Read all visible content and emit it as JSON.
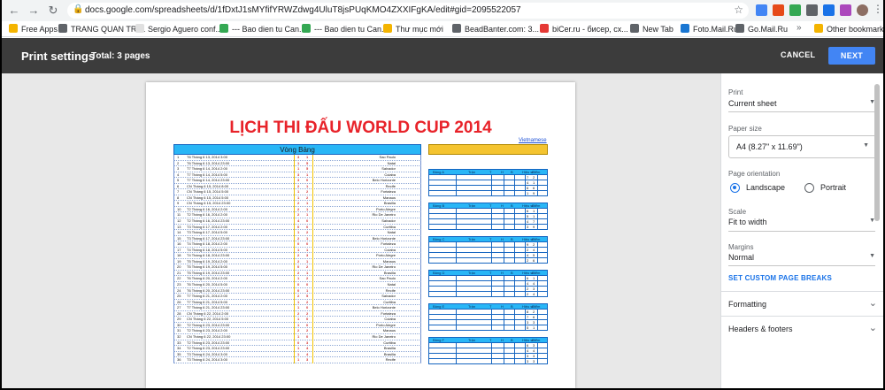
{
  "browser": {
    "url": "docs.google.com/spreadsheets/d/1fDxtJ1sMYfifYRWZdwg4UluT8jsPUqKMO4ZXXIFgKA/edit#gid=2095522057",
    "bookmarks": [
      {
        "label": "Free Apps",
        "color": "#f4b400"
      },
      {
        "label": "TRANG QUAN TRI...",
        "color": "#5f6368"
      },
      {
        "label": "Sergio Aguero conf...",
        "color": "#e0e0e0"
      },
      {
        "label": "--- Bao dien tu Can...",
        "color": "#34a853"
      },
      {
        "label": "--- Bao dien tu Can...",
        "color": "#34a853"
      },
      {
        "label": "Thư mục mới",
        "color": "#f4b400"
      },
      {
        "label": "BeadBanter.com: 3...",
        "color": "#5f6368"
      },
      {
        "label": "biCer.ru - бисер, сх...",
        "color": "#e53935"
      },
      {
        "label": "New Tab",
        "color": "#5f6368"
      },
      {
        "label": "Foto.Mail.Ru",
        "color": "#1976d2"
      },
      {
        "label": "Go.Mail.Ru",
        "color": "#5f6368"
      }
    ],
    "more_label": "»",
    "other_bookmarks": "Other bookmarks"
  },
  "header": {
    "title": "Print settings",
    "total": "Total: 3 pages",
    "cancel": "CANCEL",
    "next": "NEXT",
    "accent": "#4285f4"
  },
  "sheet": {
    "title": "LỊCH THI ĐẤU WORLD CUP 2014",
    "link": "Vietnamese",
    "group_stage_label": "Vòng Bảng",
    "matches": [
      {
        "n": "1",
        "d": "T6  Tháng 6 13, 2014   3:00",
        "s1": "3",
        "s2": "1",
        "v": "Sao Paulo"
      },
      {
        "n": "2",
        "d": "T6  Tháng 6 13, 2014   23:00",
        "s1": "1",
        "s2": "5",
        "v": "Natal"
      },
      {
        "n": "3",
        "d": "T7  Tháng 6 14, 2014   2:00",
        "s1": "1",
        "s2": "5",
        "v": "Salvador"
      },
      {
        "n": "4",
        "d": "T7  Tháng 6 14, 2014   5:00",
        "s1": "3",
        "s2": "1",
        "v": "Cuiaba"
      },
      {
        "n": "5",
        "d": "T7  Tháng 6 14, 2014   23:00",
        "s1": "3",
        "s2": "0",
        "v": "Belo Horizonte"
      },
      {
        "n": "6",
        "d": "CN  Tháng 6 15, 2014   8:00",
        "s1": "2",
        "s2": "1",
        "v": "Recife"
      },
      {
        "n": "7",
        "d": "CN  Tháng 6 15, 2014   5:00",
        "s1": "1",
        "s2": "2",
        "v": "Fortaleza"
      },
      {
        "n": "8",
        "d": "CN  Tháng 6 15, 2014   5:00",
        "s1": "1",
        "s2": "2",
        "v": "Manaus"
      },
      {
        "n": "9",
        "d": "CN  Tháng 6 15, 2014   23:00",
        "s1": "2",
        "s2": "1",
        "v": "Brasilia"
      },
      {
        "n": "10",
        "d": "T2  Tháng 6 16, 2014   2:00",
        "s1": "2",
        "s2": "1",
        "v": "Porto Alegre"
      },
      {
        "n": "11",
        "d": "T2  Tháng 6 16, 2014   2:00",
        "s1": "2",
        "s2": "1",
        "v": "Rio De Janeiro"
      },
      {
        "n": "12",
        "d": "T2  Tháng 6 16, 2014   23:00",
        "s1": "4",
        "s2": "0",
        "v": "Salvador"
      },
      {
        "n": "13",
        "d": "T3  Tháng 6 17, 2014   2:00",
        "s1": "0",
        "s2": "0",
        "v": "Curitiba"
      },
      {
        "n": "14",
        "d": "T3  Tháng 6 17, 2014   5:00",
        "s1": "1",
        "s2": "2",
        "v": "Natal"
      },
      {
        "n": "15",
        "d": "T3  Tháng 6 17, 2014   23:00",
        "s1": "2",
        "s2": "1",
        "v": "Belo Horizonte"
      },
      {
        "n": "16",
        "d": "T4  Tháng 6 18, 2014   2:00",
        "s1": "0",
        "s2": "0",
        "v": "Fortaleza"
      },
      {
        "n": "17",
        "d": "T4  Tháng 6 18, 2014   5:00",
        "s1": "1",
        "s2": "1",
        "v": "Cuiaba"
      },
      {
        "n": "18",
        "d": "T4  Tháng 6 18, 2014   23:00",
        "s1": "2",
        "s2": "3",
        "v": "Porto Alegre"
      },
      {
        "n": "19",
        "d": "T5  Tháng 6 19, 2014   2:00",
        "s1": "2",
        "s2": "1",
        "v": "Manaus"
      },
      {
        "n": "20",
        "d": "T5  Tháng 6 19, 2014   5:00",
        "s1": "0",
        "s2": "2",
        "v": "Rio De Janeiro"
      },
      {
        "n": "21",
        "d": "T5  Tháng 6 19, 2014   23:00",
        "s1": "2",
        "s2": "1",
        "v": "Brasilia"
      },
      {
        "n": "22",
        "d": "T6  Tháng 6 20, 2014   2:00",
        "s1": "1",
        "s2": "2",
        "v": "Sao Paulo"
      },
      {
        "n": "23",
        "d": "T6  Tháng 6 20, 2014   5:00",
        "s1": "0",
        "s2": "0",
        "v": "Natal"
      },
      {
        "n": "24",
        "d": "T6  Tháng 6 20, 2014   23:00",
        "s1": "0",
        "s2": "1",
        "v": "Recife"
      },
      {
        "n": "25",
        "d": "T7  Tháng 6 21, 2014   2:00",
        "s1": "2",
        "s2": "5",
        "v": "Salvador"
      },
      {
        "n": "26",
        "d": "T7  Tháng 6 21, 2014   5:00",
        "s1": "1",
        "s2": "2",
        "v": "Curitiba"
      },
      {
        "n": "27",
        "d": "T7  Tháng 6 21, 2014   23:00",
        "s1": "1",
        "s2": "0",
        "v": "Belo Horizonte"
      },
      {
        "n": "28",
        "d": "CN  Tháng 6 22, 2014   2:00",
        "s1": "2",
        "s2": "2",
        "v": "Fortaleza"
      },
      {
        "n": "29",
        "d": "CN  Tháng 6 22, 2014   5:00",
        "s1": "1",
        "s2": "0",
        "v": "Cuiaba"
      },
      {
        "n": "30",
        "d": "T2  Tháng 6 23, 2014   23:00",
        "s1": "1",
        "s2": "0",
        "v": "Porto Alegre"
      },
      {
        "n": "31",
        "d": "T2  Tháng 6 23, 2014   2:00",
        "s1": "2",
        "s2": "2",
        "v": "Manaus"
      },
      {
        "n": "32",
        "d": "CN  Tháng 6 22, 2014   23:00",
        "s1": "1",
        "s2": "0",
        "v": "Rio De Janeiro"
      },
      {
        "n": "33",
        "d": "T2  Tháng 6 23, 2014   23:00",
        "s1": "0",
        "s2": "3",
        "v": "Curitiba"
      },
      {
        "n": "34",
        "d": "T2  Tháng 6 23, 2014   23:00",
        "s1": "1",
        "s2": "4",
        "v": "Brasilia"
      },
      {
        "n": "35",
        "d": "T3  Tháng 6 24, 2014   3:00",
        "s1": "1",
        "s2": "4",
        "v": "Brasilia"
      },
      {
        "n": "36",
        "d": "T3  Tháng 6 24, 2014   3:00",
        "s1": "1",
        "s2": "3",
        "v": "Recife"
      }
    ],
    "group_headers": [
      "Bảng A",
      "Bảng B",
      "Bảng C",
      "Bảng D",
      "Bảng E",
      "Bảng F"
    ],
    "group_cols": [
      "Trận",
      "T",
      "H",
      "B",
      "Hiệu số",
      "Điểm"
    ],
    "group_points": [
      [
        [
          "7",
          "2"
        ],
        [
          "4",
          "1"
        ],
        [
          "6",
          "6"
        ],
        [
          "1",
          "9"
        ]
      ],
      [
        [
          "6",
          "1"
        ],
        [
          "5",
          "1"
        ],
        [
          "4",
          "7"
        ],
        [
          "3",
          "9"
        ]
      ],
      [
        [
          "9",
          "2"
        ],
        [
          "2",
          "4"
        ],
        [
          "4",
          "5"
        ],
        [
          "2",
          "6"
        ]
      ],
      [
        [
          "6",
          "1"
        ],
        [
          "4",
          "4"
        ],
        [
          "2",
          "3"
        ],
        [
          "2",
          "4"
        ]
      ],
      [
        [
          "8",
          "2"
        ],
        [
          "7",
          "6"
        ],
        [
          "3",
          "3"
        ],
        [
          "5",
          "1"
        ]
      ],
      [
        [
          "6",
          "3"
        ],
        [
          "4",
          "4"
        ],
        [
          "3",
          "3"
        ],
        [
          "3",
          "3"
        ]
      ]
    ]
  },
  "settings": {
    "print_label": "Print",
    "print_value": "Current sheet",
    "paper_label": "Paper size",
    "paper_value": "A4 (8.27\" x 11.69\")",
    "orientation_label": "Page orientation",
    "landscape": "Landscape",
    "portrait": "Portrait",
    "scale_label": "Scale",
    "scale_value": "Fit to width",
    "margins_label": "Margins",
    "margins_value": "Normal",
    "custom_breaks": "SET CUSTOM PAGE BREAKS",
    "formatting": "Formatting",
    "headers_footers": "Headers & footers"
  }
}
